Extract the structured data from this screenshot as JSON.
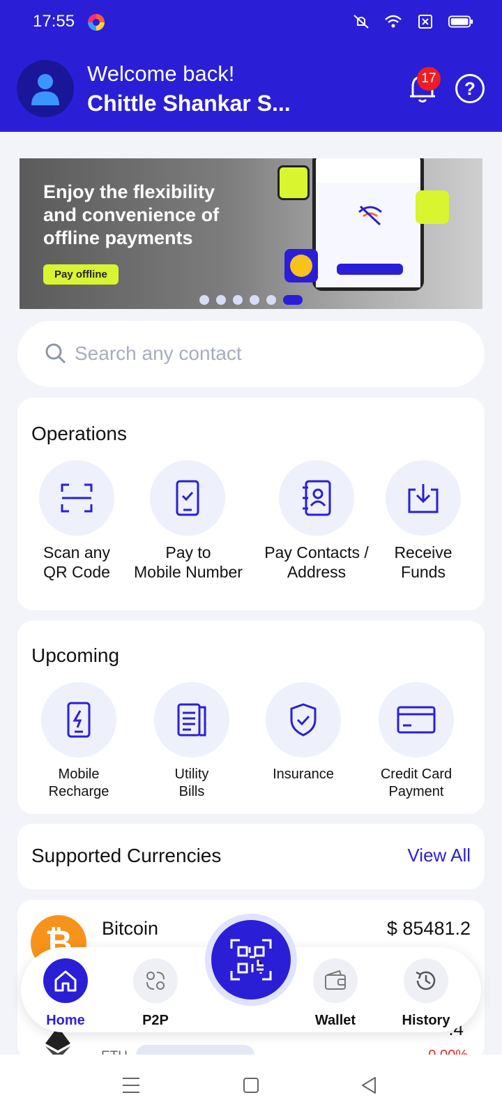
{
  "status_bar": {
    "time": "17:55"
  },
  "header": {
    "welcome": "Welcome back!",
    "user_name": "Chittle Shankar S...",
    "notification_count": "17"
  },
  "banner": {
    "line1": "Enjoy the flexibility",
    "line2": "and convenience of",
    "line3_bold": "offline",
    "line3_rest": " payments",
    "cta": "Pay offline",
    "slides_total": 6,
    "active_slide": 6
  },
  "search": {
    "placeholder": "Search any contact"
  },
  "operations": {
    "title": "Operations",
    "items": [
      {
        "label": "Scan any\nQR Code",
        "icon": "scan-icon"
      },
      {
        "label": "Pay to\nMobile Number",
        "icon": "mobile-pay-icon"
      },
      {
        "label": "Pay Contacts /\nAddress",
        "icon": "contacts-icon"
      },
      {
        "label": "Receive\nFunds",
        "icon": "receive-icon"
      }
    ]
  },
  "upcoming": {
    "title": "Upcoming",
    "items": [
      {
        "label": "Mobile\nRecharge",
        "icon": "mobile-recharge-icon"
      },
      {
        "label": "Utility\nBills",
        "icon": "bill-icon"
      },
      {
        "label": "Insurance",
        "icon": "shield-icon"
      },
      {
        "label": "Credit Card\nPayment",
        "icon": "credit-card-icon"
      }
    ]
  },
  "currencies": {
    "title": "Supported Currencies",
    "view_all": "View All",
    "items": [
      {
        "name": "Bitcoin",
        "price": "$ 85481.2"
      },
      {
        "symbol": "ETH",
        "value": ".4",
        "change": "-0.00%"
      }
    ]
  },
  "bottom_nav": {
    "items": [
      {
        "label": "Home",
        "icon": "home-icon",
        "active": true
      },
      {
        "label": "P2P",
        "icon": "p2p-icon",
        "active": false
      },
      {
        "label": "Wallet",
        "icon": "wallet-icon",
        "active": false
      },
      {
        "label": "History",
        "icon": "history-icon",
        "active": false
      }
    ],
    "center_icon": "qr-scan-icon"
  },
  "colors": {
    "primary": "#2a1fd6",
    "accent": "#d9f530",
    "badge": "#ef1c24"
  }
}
